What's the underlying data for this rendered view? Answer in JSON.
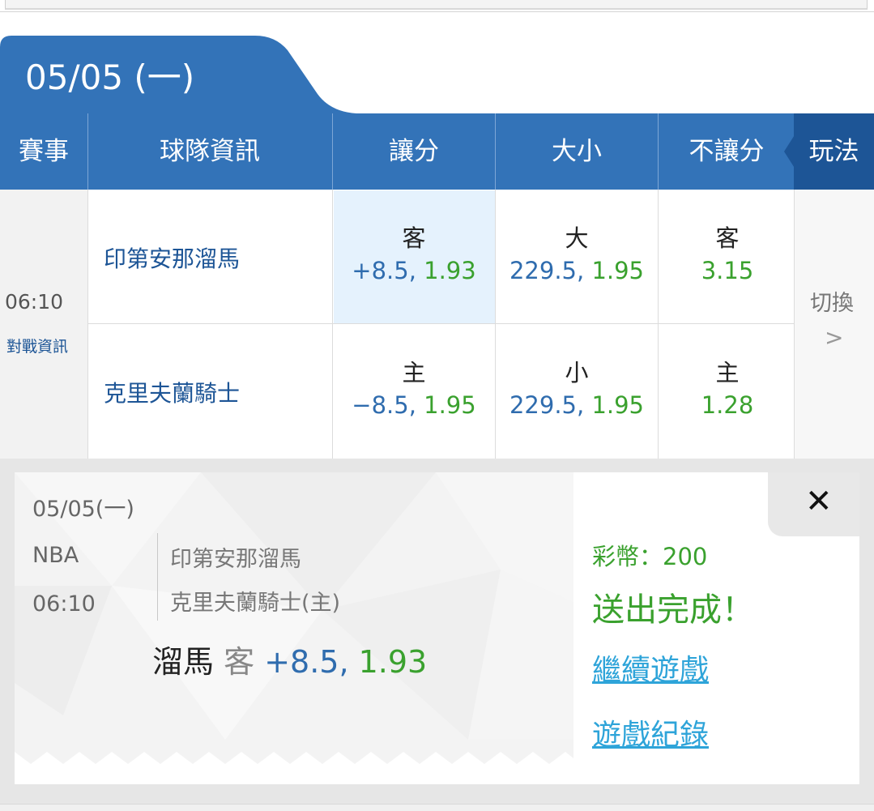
{
  "date_tab": {
    "label": "05/05 (一)"
  },
  "header": {
    "event": "賽事",
    "team_info": "球隊資訊",
    "spread": "讓分",
    "total": "大小",
    "moneyline": "不讓分",
    "play": "玩法"
  },
  "match": {
    "time": "06:10",
    "vs_info": "對戰資訊",
    "away_team": "印第安那溜馬",
    "home_team": "克里夫蘭騎士",
    "spread": {
      "away_label": "客",
      "away_value": "+8.5, ",
      "away_odds": "1.93",
      "home_label": "主",
      "home_value": "−8.5, ",
      "home_odds": "1.95"
    },
    "total": {
      "over_label": "大",
      "over_value": "229.5, ",
      "over_odds": "1.95",
      "under_label": "小",
      "under_value": "229.5, ",
      "under_odds": "1.95"
    },
    "moneyline": {
      "away_label": "客",
      "away_odds": "3.15",
      "home_label": "主",
      "home_odds": "1.28"
    },
    "switch": {
      "label": "切換",
      "arrow": ">"
    }
  },
  "ticket": {
    "date": "05/05(一)",
    "league": "NBA",
    "time": "06:10",
    "away": "印第安那溜馬",
    "home": "克里夫蘭騎士(主)",
    "pick_team": "溜馬",
    "pick_side": " 客 ",
    "pick_line": "+8.5, ",
    "pick_odds": "1.93"
  },
  "result": {
    "close": "✕",
    "coins": "彩幣：200",
    "status": "送出完成！",
    "continue_link": "繼續遊戲",
    "history_link": "遊戲紀錄"
  },
  "colors": {
    "header_blue": "#3373b8",
    "dark_blue": "#1d5596",
    "odds_blue": "#2f6cae",
    "odds_green": "#3aa12e",
    "link_cyan": "#2ea4d9",
    "highlight": "#e5f2fd"
  }
}
